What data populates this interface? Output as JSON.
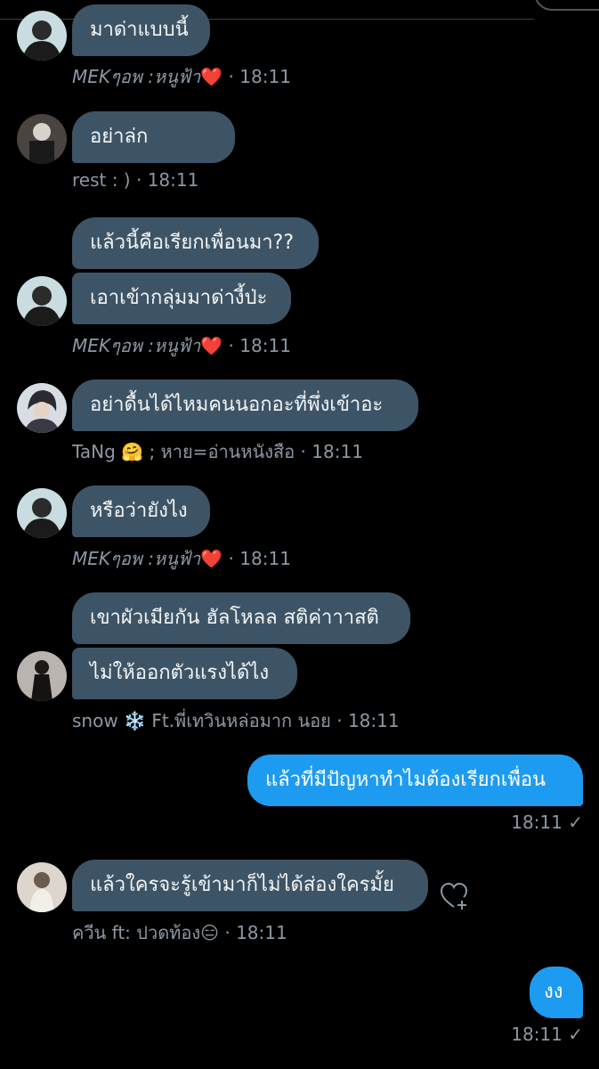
{
  "messages": [
    {
      "text": "มาด่าแบบนี้",
      "meta_name": "MEKๆอพ :หนูฟ้า",
      "meta_emoji": "❤️",
      "time": "18:11"
    },
    {
      "text": "อย่าล่ก",
      "meta_name": "rest : )",
      "time": "18:11"
    },
    {
      "text": "แล้วนี้คือเรียกเพื่อนมา??"
    },
    {
      "text": "เอาเข้ากลุ่มมาด่างี้ป่ะ",
      "meta_name": "MEKๆอพ :หนูฟ้า",
      "meta_emoji": "❤️",
      "time": "18:11"
    },
    {
      "text": "อย่าดื้นได้ไหมคนนอกอะที่พึ่งเข้าอะ",
      "meta_name": "TaNg",
      "meta_emoji": "🤗",
      "meta_suffix": "; หาย=อ่านหนังสือ",
      "time": "18:11"
    },
    {
      "text": "หรือว่ายังไง",
      "meta_name": "MEKๆอพ :หนูฟ้า",
      "meta_emoji": "❤️",
      "time": "18:11"
    },
    {
      "text": "เขาผัวเมียกัน ฮัลโหลล สติค่าาาสติ"
    },
    {
      "text": "ไม่ให้ออกตัวแรงได้ไง",
      "meta_name": "snow",
      "meta_emoji": "❄️",
      "meta_suffix": "Ft.พี่เทวินหล่อมาก นอย",
      "time": "18:11"
    },
    {
      "text": "แล้วที่มีปัญหาทำไมต้องเรียกเพื่อน",
      "time": "18:11",
      "check": "✓"
    },
    {
      "text": "แล้วใครจะรู้เข้ามาก็ไม่ได้ส่องใครมั้ย",
      "meta_name": "ควีน ft: ปวดท้อง",
      "meta_emoji": "😑",
      "time": "18:11"
    },
    {
      "text": "งง",
      "time": "18:11",
      "check": "✓"
    }
  ],
  "separator": " · ",
  "colors": {
    "incoming": "#3d5466",
    "outgoing": "#1d9bf0",
    "meta": "#8b98a5"
  }
}
